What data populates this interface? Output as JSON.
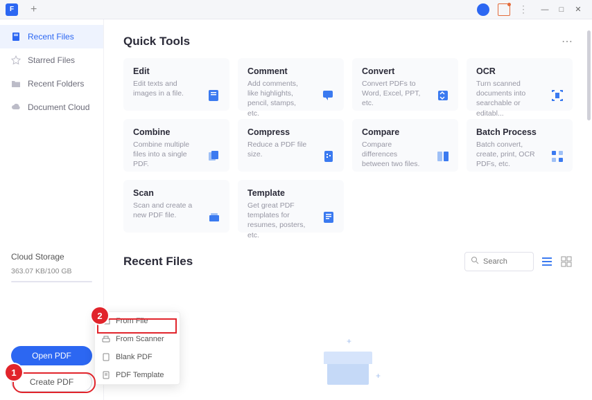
{
  "titlebar": {
    "app_glyph": "F",
    "plus": "+",
    "avatar_glyph": "",
    "menu_glyph": "⋮",
    "minimize": "—",
    "maximize": "□",
    "close": "✕"
  },
  "sidebar": {
    "items": [
      {
        "label": "Recent Files",
        "active": true,
        "icon": "file-icon"
      },
      {
        "label": "Starred Files",
        "active": false,
        "icon": "star-icon"
      },
      {
        "label": "Recent Folders",
        "active": false,
        "icon": "folder-icon"
      },
      {
        "label": "Document Cloud",
        "active": false,
        "icon": "cloud-icon"
      }
    ],
    "cloud_storage": {
      "title": "Cloud Storage",
      "value": "363.07 KB/100 GB"
    },
    "open_btn": "Open PDF",
    "create_btn": "Create PDF"
  },
  "quick_tools": {
    "title": "Quick Tools",
    "menu_glyph": "⋯",
    "cards": [
      {
        "title": "Edit",
        "desc": "Edit texts and images in a file.",
        "icon": "edit-icon"
      },
      {
        "title": "Comment",
        "desc": "Add comments, like highlights, pencil, stamps, etc.",
        "icon": "comment-icon"
      },
      {
        "title": "Convert",
        "desc": "Convert PDFs to Word, Excel, PPT, etc.",
        "icon": "convert-icon"
      },
      {
        "title": "OCR",
        "desc": "Turn scanned documents into searchable or editabl...",
        "icon": "ocr-icon"
      },
      {
        "title": "Combine",
        "desc": "Combine multiple files into a single PDF.",
        "icon": "combine-icon"
      },
      {
        "title": "Compress",
        "desc": "Reduce a PDF file size.",
        "icon": "compress-icon"
      },
      {
        "title": "Compare",
        "desc": "Compare differences between two files.",
        "icon": "compare-icon"
      },
      {
        "title": "Batch Process",
        "desc": "Batch convert, create, print, OCR PDFs, etc.",
        "icon": "batch-icon"
      },
      {
        "title": "Scan",
        "desc": "Scan and create a new PDF file.",
        "icon": "scan-icon"
      },
      {
        "title": "Template",
        "desc": "Get great PDF templates for resumes, posters, etc.",
        "icon": "template-icon"
      }
    ]
  },
  "recent": {
    "title": "Recent Files",
    "search_placeholder": "Search"
  },
  "context_menu": {
    "items": [
      {
        "label": "From File",
        "icon": "folder-outline-icon"
      },
      {
        "label": "From Scanner",
        "icon": "scanner-icon"
      },
      {
        "label": "Blank PDF",
        "icon": "blank-icon"
      },
      {
        "label": "PDF Template",
        "icon": "template-small-icon"
      }
    ]
  },
  "annotations": {
    "badge1": "1",
    "badge2": "2"
  }
}
